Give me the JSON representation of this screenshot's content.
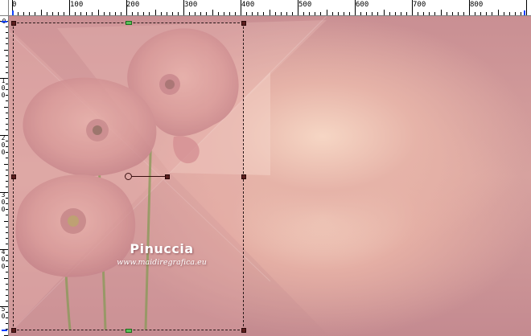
{
  "ruler": {
    "h_labels": [
      "0",
      "100",
      "200",
      "300",
      "400",
      "500",
      "600",
      "700",
      "800"
    ],
    "v_labels": [
      "0",
      "1 0 0",
      "2 0 0",
      "3 0 0",
      "4 0 0",
      "5 0"
    ]
  },
  "watermark": {
    "title": "Pinuccia",
    "site": "www.maidiregrafica.eu"
  },
  "colors": {
    "canvas_glow": "#f6d6c4",
    "canvas_rose": "#c98f93",
    "selection_handle": "#5a1e1e",
    "selection_handle_mid": "#5ac05a",
    "ruler_marker": "#1040ff"
  }
}
